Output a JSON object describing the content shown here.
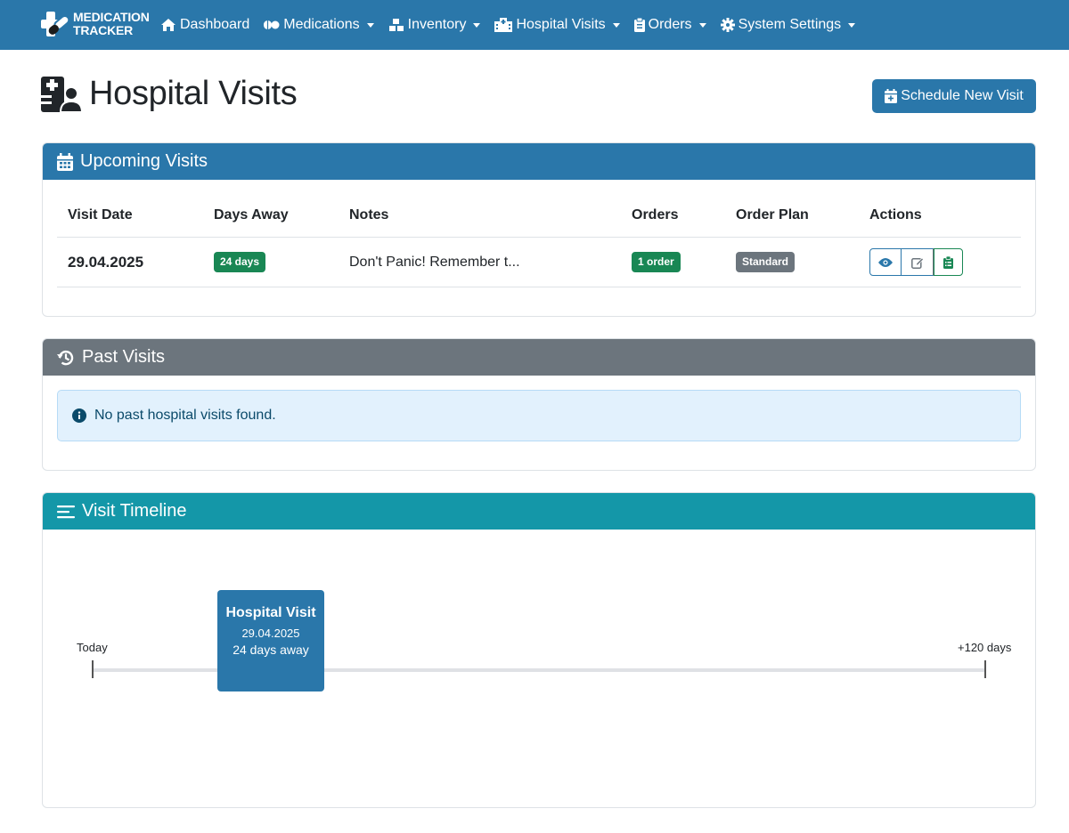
{
  "brand": {
    "line1": "MEDICATION",
    "line2": "TRACKER"
  },
  "nav": [
    {
      "label": "Dashboard",
      "icon": "home-icon",
      "dropdown": false
    },
    {
      "label": "Medications",
      "icon": "pills-icon",
      "dropdown": true
    },
    {
      "label": "Inventory",
      "icon": "boxes-icon",
      "dropdown": true
    },
    {
      "label": "Hospital Visits",
      "icon": "hospital-icon",
      "dropdown": true
    },
    {
      "label": "Orders",
      "icon": "clipboard-icon",
      "dropdown": true
    },
    {
      "label": "System Settings",
      "icon": "gear-icon",
      "dropdown": true
    }
  ],
  "page": {
    "title": "Hospital Visits",
    "schedule_button": "Schedule New Visit"
  },
  "upcoming": {
    "title": "Upcoming Visits",
    "columns": [
      "Visit Date",
      "Days Away",
      "Notes",
      "Orders",
      "Order Plan",
      "Actions"
    ],
    "rows": [
      {
        "date": "29.04.2025",
        "days_away": "24 days",
        "notes": "Don't Panic! Remember t...",
        "orders": "1 order",
        "plan": "Standard"
      }
    ]
  },
  "past": {
    "title": "Past Visits",
    "empty_message": "No past hospital visits found."
  },
  "timeline": {
    "title": "Visit Timeline",
    "start_label": "Today",
    "end_label": "+120 days",
    "event": {
      "title": "Hospital Visit",
      "date": "29.04.2025",
      "away": "24 days away",
      "days": 24,
      "range_days": 120
    }
  },
  "colors": {
    "primary": "#2a77aa",
    "secondary": "#6c757d",
    "info": "#1497a8",
    "success": "#198754"
  }
}
